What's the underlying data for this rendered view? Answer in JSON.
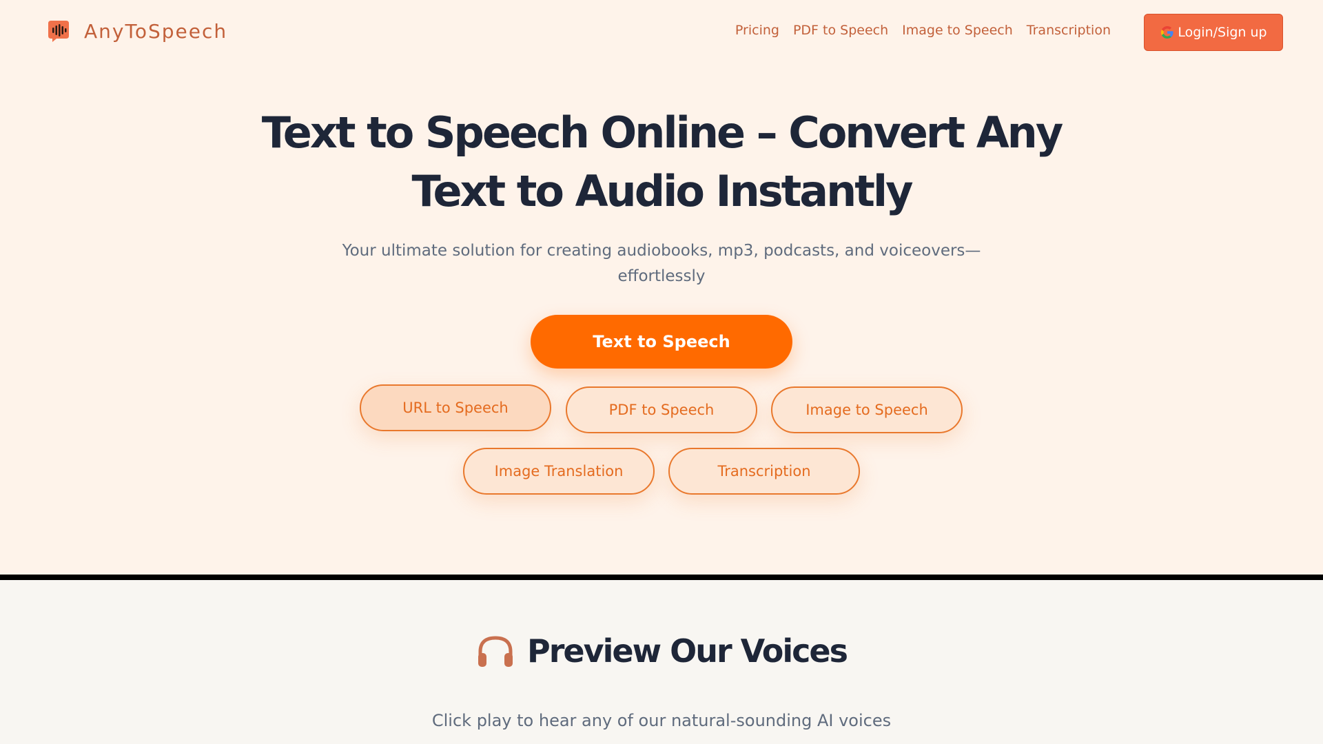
{
  "brand": {
    "name": "AnyToSpeech",
    "logo_icon": "speech-bubble-waveform-icon"
  },
  "nav": {
    "links": [
      "Pricing",
      "PDF to Speech",
      "Image to Speech",
      "Transcription"
    ],
    "login_label": "Login/Sign up",
    "login_icon": "google-icon"
  },
  "hero": {
    "title": "Text to Speech Online – Convert Any Text to Audio Instantly",
    "subtitle": "Your ultimate solution for creating audiobooks, mp3, podcasts, and voiceovers—effortlessly",
    "primary_cta": "Text to Speech",
    "tool_pills": [
      "URL to Speech",
      "PDF to Speech",
      "Image to Speech",
      "Image Translation",
      "Transcription"
    ]
  },
  "preview": {
    "icon": "headphones-icon",
    "title": "Preview Our Voices",
    "subtitle": "Click play to hear any of our natural-sounding AI voices"
  },
  "colors": {
    "accent": "#ff6a00",
    "brand_text": "#c2603a",
    "login_bg": "#f26a42",
    "heading": "#1e2638",
    "hero_bg": "#fef3ea",
    "pill_border": "#e9782c"
  }
}
